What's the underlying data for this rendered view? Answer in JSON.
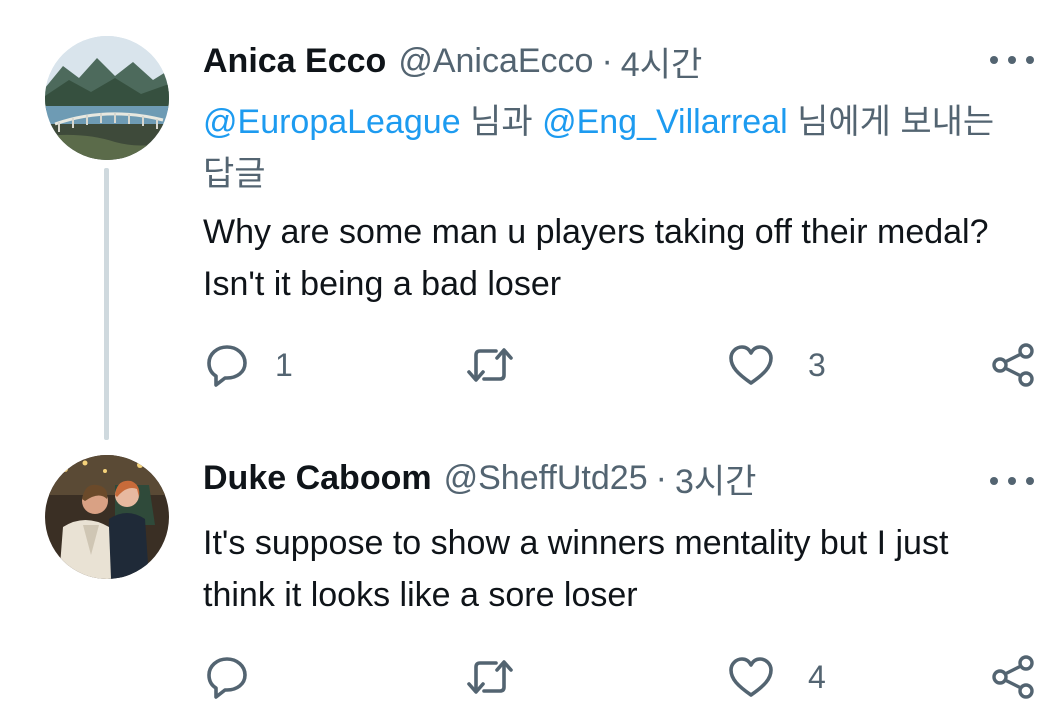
{
  "tweets": [
    {
      "author": {
        "name": "Anica Ecco",
        "handle": "@AnicaEcco",
        "avatar": "landscape-lake-avatar"
      },
      "separator": "·",
      "time": "4시간",
      "reply_to": {
        "mention_1": "@EuropaLeague",
        "conj": " 님과 ",
        "mention_2": "@Eng_Villarreal",
        "suffix": " 님에게 보내는 답글"
      },
      "text": "Why are some man u players taking off their medal? Isn't it being a bad loser",
      "stats": {
        "replies": "1",
        "retweets": "",
        "likes": "3"
      }
    },
    {
      "author": {
        "name": "Duke Caboom",
        "handle": "@SheffUtd25",
        "avatar": "couple-photo-avatar"
      },
      "separator": "·",
      "time": "3시간",
      "text": "It's suppose to show a winners mentality but I just think it looks like a sore loser",
      "stats": {
        "replies": "",
        "retweets": "",
        "likes": "4"
      }
    }
  ],
  "icons": {
    "reply": "comment-bubble-icon",
    "retweet": "retweet-arrows-icon",
    "like": "heart-outline-icon",
    "share": "share-nodes-icon",
    "more": "more-dots-icon"
  },
  "colors": {
    "text": "#0f1419",
    "secondary": "#536471",
    "link": "#1d9bf0",
    "thread_line": "#cfd9de"
  }
}
